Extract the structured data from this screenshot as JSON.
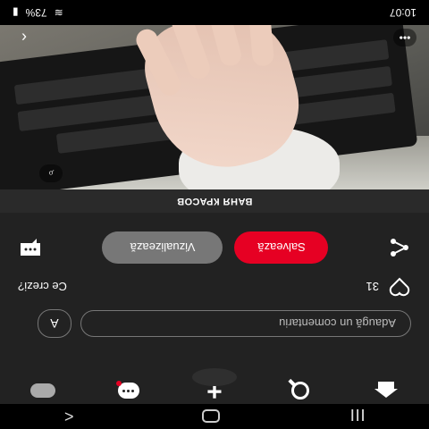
{
  "status_bar": {
    "time": "10:07",
    "battery": "73%"
  },
  "pin": {
    "title": "ВАНЯ КРАСОВ"
  },
  "actions": {
    "view_label": "Vizualizează",
    "save_label": "Salvează"
  },
  "reactions": {
    "prompt": "Ce crezi?",
    "count": "31"
  },
  "comment": {
    "avatar_letter": "A",
    "placeholder": "Adaugă un comentariu"
  },
  "icons": {
    "back": "chevron-left-icon",
    "more": "more-dots-icon",
    "lens": "visual-search-icon",
    "comment": "comment-bubble-icon",
    "share": "share-icon",
    "heart": "heart-icon",
    "home": "home-icon",
    "search": "search-icon",
    "create": "plus-icon",
    "messages": "chat-icon",
    "profile": "avatar-icon"
  },
  "colors": {
    "accent": "#e60023",
    "background": "#222222"
  }
}
